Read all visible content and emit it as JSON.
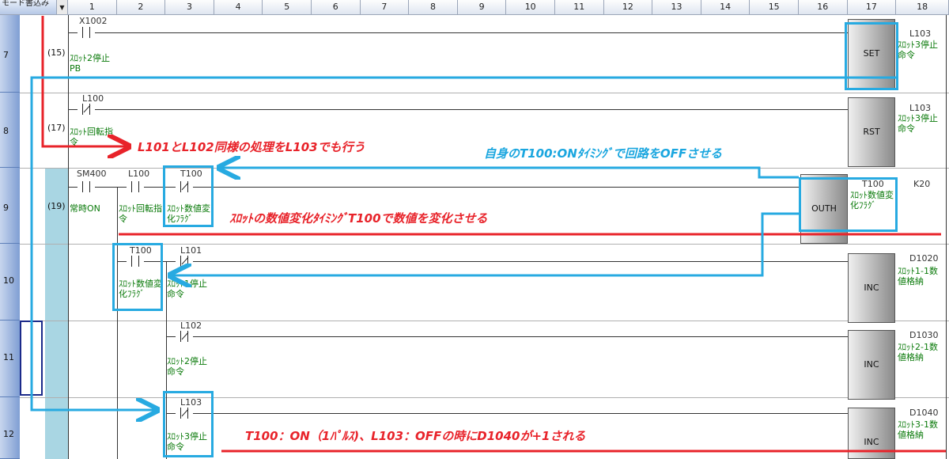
{
  "header": {
    "mode_label": "モード書込み",
    "dropdown_icon": "chevron-down-icon",
    "columns": [
      "1",
      "2",
      "3",
      "4",
      "5",
      "6",
      "7",
      "8",
      "9",
      "10",
      "11",
      "12",
      "13",
      "14",
      "15",
      "16",
      "17",
      "18"
    ]
  },
  "rows": [
    {
      "no": "7",
      "step": "(15)",
      "contact_device": "X1002",
      "contact_comment": "ｽﾛｯﾄ2停止PB",
      "instr": "SET",
      "instr_device": "L103",
      "instr_comment": "ｽﾛｯﾄ3停止命令"
    },
    {
      "no": "8",
      "step": "(17)",
      "contact_device": "L100",
      "contact_comment": "ｽﾛｯﾄ回転指令",
      "instr": "RST",
      "instr_device": "L103",
      "instr_comment": "ｽﾛｯﾄ3停止命令"
    },
    {
      "no": "9",
      "step": "(19)",
      "c1_device": "SM400",
      "c1_comment": "常時ON",
      "c2_device": "L100",
      "c2_comment": "ｽﾛｯﾄ回転指令",
      "c3_device": "T100",
      "c3_comment": "ｽﾛｯﾄ数値変化ﾌﾗｸﾞ",
      "instr": "OUTH",
      "instr_device": "T100",
      "instr_const": "K20",
      "instr_comment": "ｽﾛｯﾄ数値変化ﾌﾗｸﾞ"
    },
    {
      "no": "10",
      "c1_device": "T100",
      "c1_comment": "ｽﾛｯﾄ数値変化ﾌﾗｸﾞ",
      "c2_device": "L101",
      "c2_comment": "ｽﾛｯﾄ1停止命令",
      "instr": "INC",
      "instr_device": "D1020",
      "instr_comment": "ｽﾛｯﾄ1-1数値格納"
    },
    {
      "no": "11",
      "c2_device": "L102",
      "c2_comment": "ｽﾛｯﾄ2停止命令",
      "instr": "INC",
      "instr_device": "D1030",
      "instr_comment": "ｽﾛｯﾄ2-1数値格納"
    },
    {
      "no": "12",
      "c2_device": "L103",
      "c2_comment": "ｽﾛｯﾄ3停止命令",
      "instr": "INC",
      "instr_device": "D1040",
      "instr_comment": "ｽﾛｯﾄ3-1数値格納"
    }
  ],
  "annotations": {
    "a1": "L101とL102同様の処理をL103でも行う",
    "a2": "自身のT100:ONﾀｲﾐﾝｸﾞで回路をOFFさせる",
    "a3": "ｽﾛｯﾄの数値変化ﾀｲﾐﾝｸﾞT100で数値を変化させる",
    "a4": "T100：ON（1ﾊﾟﾙｽ)、L103：OFFの時にD1040が+1される"
  },
  "colors": {
    "red": "#e8232a",
    "blue": "#1aa6df",
    "comment_green": "#0a7a0a"
  }
}
